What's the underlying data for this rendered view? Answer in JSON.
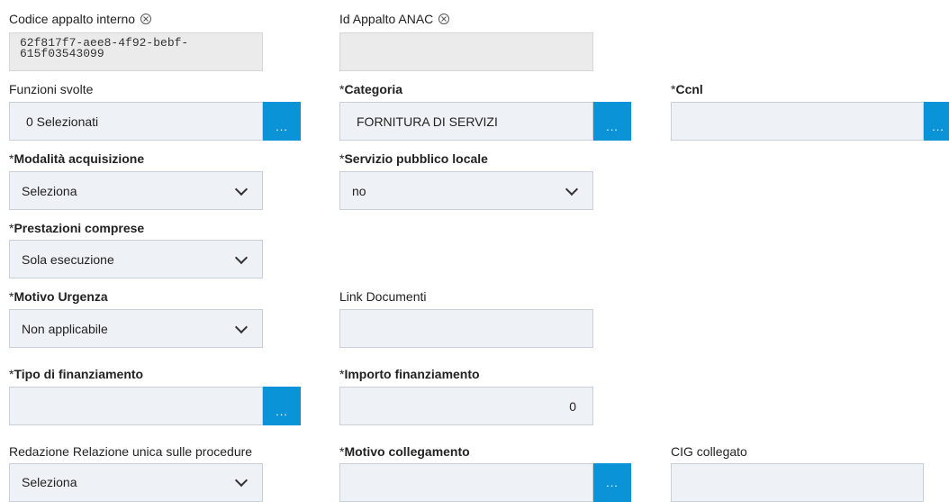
{
  "fields": {
    "codice": {
      "label": "Codice appalto interno",
      "value": "62f817f7-aee8-4f92-bebf-615f03543099",
      "value_line1": "62f817f7-aee8-4f92-bebf-",
      "value_line2": "615f03543099"
    },
    "idAnac": {
      "label": "Id Appalto ANAC",
      "value": ""
    },
    "funzioni": {
      "label": "Funzioni svolte",
      "value": "0 Selezionati",
      "button": "..."
    },
    "categoria": {
      "required": "*",
      "label": "Categoria",
      "value": "FORNITURA DI SERVIZI",
      "button": "..."
    },
    "ccnl": {
      "required": "*",
      "label": "Ccnl",
      "value": "",
      "button": "..."
    },
    "modalita": {
      "required": "*",
      "label": "Modalità acquisizione",
      "value": "Seleziona"
    },
    "servizio": {
      "required": "*",
      "label": "Servizio pubblico locale",
      "value": "no"
    },
    "prestazioni": {
      "required": "*",
      "label": "Prestazioni comprese",
      "value": "Sola esecuzione"
    },
    "motivoUrgenza": {
      "required": "*",
      "label": "Motivo Urgenza",
      "value": "Non applicabile"
    },
    "link": {
      "label": "Link Documenti",
      "value": ""
    },
    "tipoFin": {
      "required": "*",
      "label": "Tipo di finanziamento",
      "value": "",
      "button": "..."
    },
    "importoFin": {
      "required": "*",
      "label": "Importo finanziamento",
      "value": "0"
    },
    "redazione": {
      "label": "Redazione Relazione unica sulle procedure",
      "value": "Seleziona"
    },
    "motivoColl": {
      "required": "*",
      "label": "Motivo collegamento",
      "value": "",
      "button": "..."
    },
    "cig": {
      "label": "CIG collegato",
      "value": ""
    }
  },
  "icons": {
    "clear": "circle-x-icon",
    "dropdown": "chevron-down-icon",
    "picker": "ellipsis-button"
  },
  "colors": {
    "accent": "#0a93d6",
    "field_bg": "#eef1f5",
    "readonly_bg": "#ebebeb"
  }
}
